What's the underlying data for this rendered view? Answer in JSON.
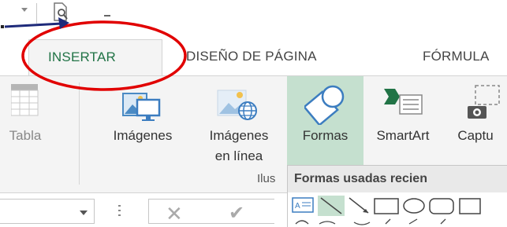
{
  "tabs": {
    "active": "INSERTAR",
    "diseno": "DISEÑO DE PÁGINA",
    "formulas": "FÓRMULA"
  },
  "ribbon": {
    "tabla": "Tabla",
    "imagenes": "Imágenes",
    "imagenes_linea_1": "Imágenes",
    "imagenes_linea_2": "en línea",
    "formas": "Formas",
    "smartart": "SmartArt",
    "captura": "Captu",
    "group_label": "Ilus"
  },
  "dropdown": {
    "title": "Formas usadas recien"
  },
  "colors": {
    "accent_green": "#217346",
    "formas_highlight": "#c5e0cf",
    "annotation_red": "#e10000",
    "arrow_navy": "#1e2a7a"
  },
  "icons": [
    "dropdown-icon",
    "print-preview-icon",
    "table-icon",
    "pictures-icon",
    "online-pictures-icon",
    "shapes-icon",
    "smartart-icon",
    "screenshot-icon",
    "cancel-icon",
    "check-icon"
  ]
}
